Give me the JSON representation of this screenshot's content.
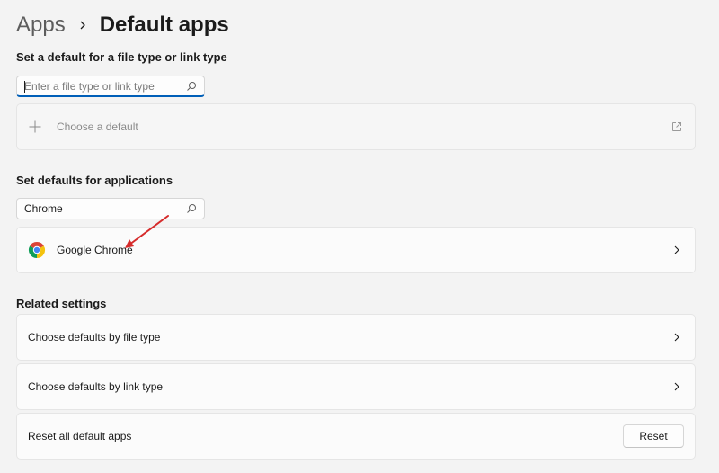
{
  "header": {
    "parent": "Apps",
    "current": "Default apps"
  },
  "file_type_section": {
    "title": "Set a default for a file type or link type",
    "search_placeholder": "Enter a file type or link type",
    "choose_label": "Choose a default"
  },
  "apps_section": {
    "title": "Set defaults for applications",
    "search_value": "Chrome",
    "result_label": "Google Chrome"
  },
  "related": {
    "title": "Related settings",
    "items": [
      {
        "label": "Choose defaults by file type"
      },
      {
        "label": "Choose defaults by link type"
      }
    ],
    "reset_label": "Reset all default apps",
    "reset_button": "Reset"
  },
  "annotation_color": "#d62b2b",
  "accent_color": "#005fb8",
  "icons": [
    "chevron-right-icon",
    "search-icon",
    "plus-icon",
    "open-external-icon",
    "chrome-icon",
    "annotation-arrow"
  ]
}
